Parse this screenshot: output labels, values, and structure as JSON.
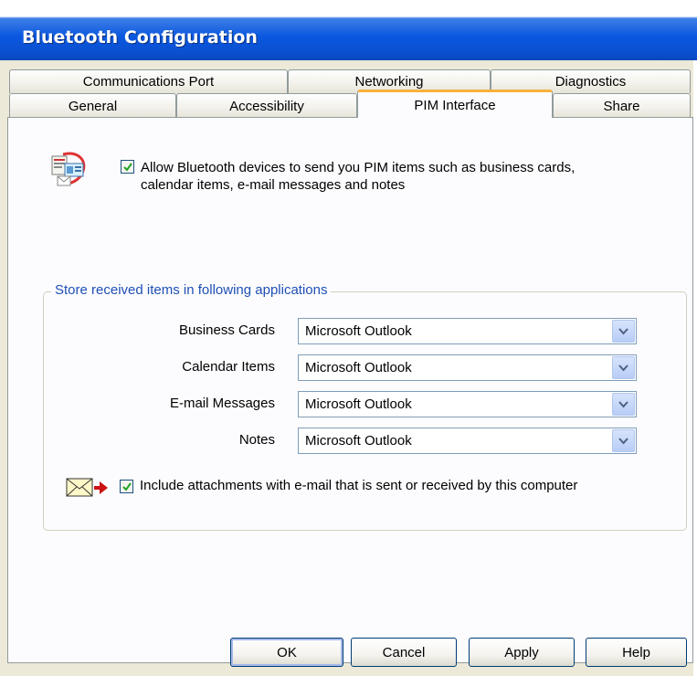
{
  "window": {
    "title": "Bluetooth Configuration"
  },
  "tabs": {
    "back_row": [
      "Communications Port",
      "Networking",
      "Diagnostics"
    ],
    "front_row": [
      "General",
      "Accessibility",
      "PIM Interface",
      "Share"
    ],
    "active": "PIM Interface"
  },
  "pim": {
    "allow_checked": true,
    "allow_label_line1": "Allow Bluetooth devices to send you PIM items such as business cards,",
    "allow_label_line2": "calendar items, e-mail messages and notes",
    "icon": "pim-cards-icon"
  },
  "store": {
    "legend": "Store received items in following applications",
    "rows": [
      {
        "label": "Business Cards",
        "value": "Microsoft Outlook"
      },
      {
        "label": "Calendar Items",
        "value": "Microsoft Outlook"
      },
      {
        "label": "E-mail Messages",
        "value": "Microsoft Outlook"
      },
      {
        "label": "Notes",
        "value": "Microsoft Outlook"
      }
    ],
    "attach_checked": true,
    "attach_label": "Include attachments with e-mail that is sent or received by this computer",
    "attach_icon": "envelope-arrow-icon"
  },
  "buttons": {
    "ok": "OK",
    "cancel": "Cancel",
    "apply": "Apply",
    "help": "Help"
  },
  "colors": {
    "title_bar": "#0a58e0",
    "active_tab_accent": "#f7b13d",
    "group_legend": "#1f4fb4",
    "combo_arrow": "#4d6185"
  }
}
